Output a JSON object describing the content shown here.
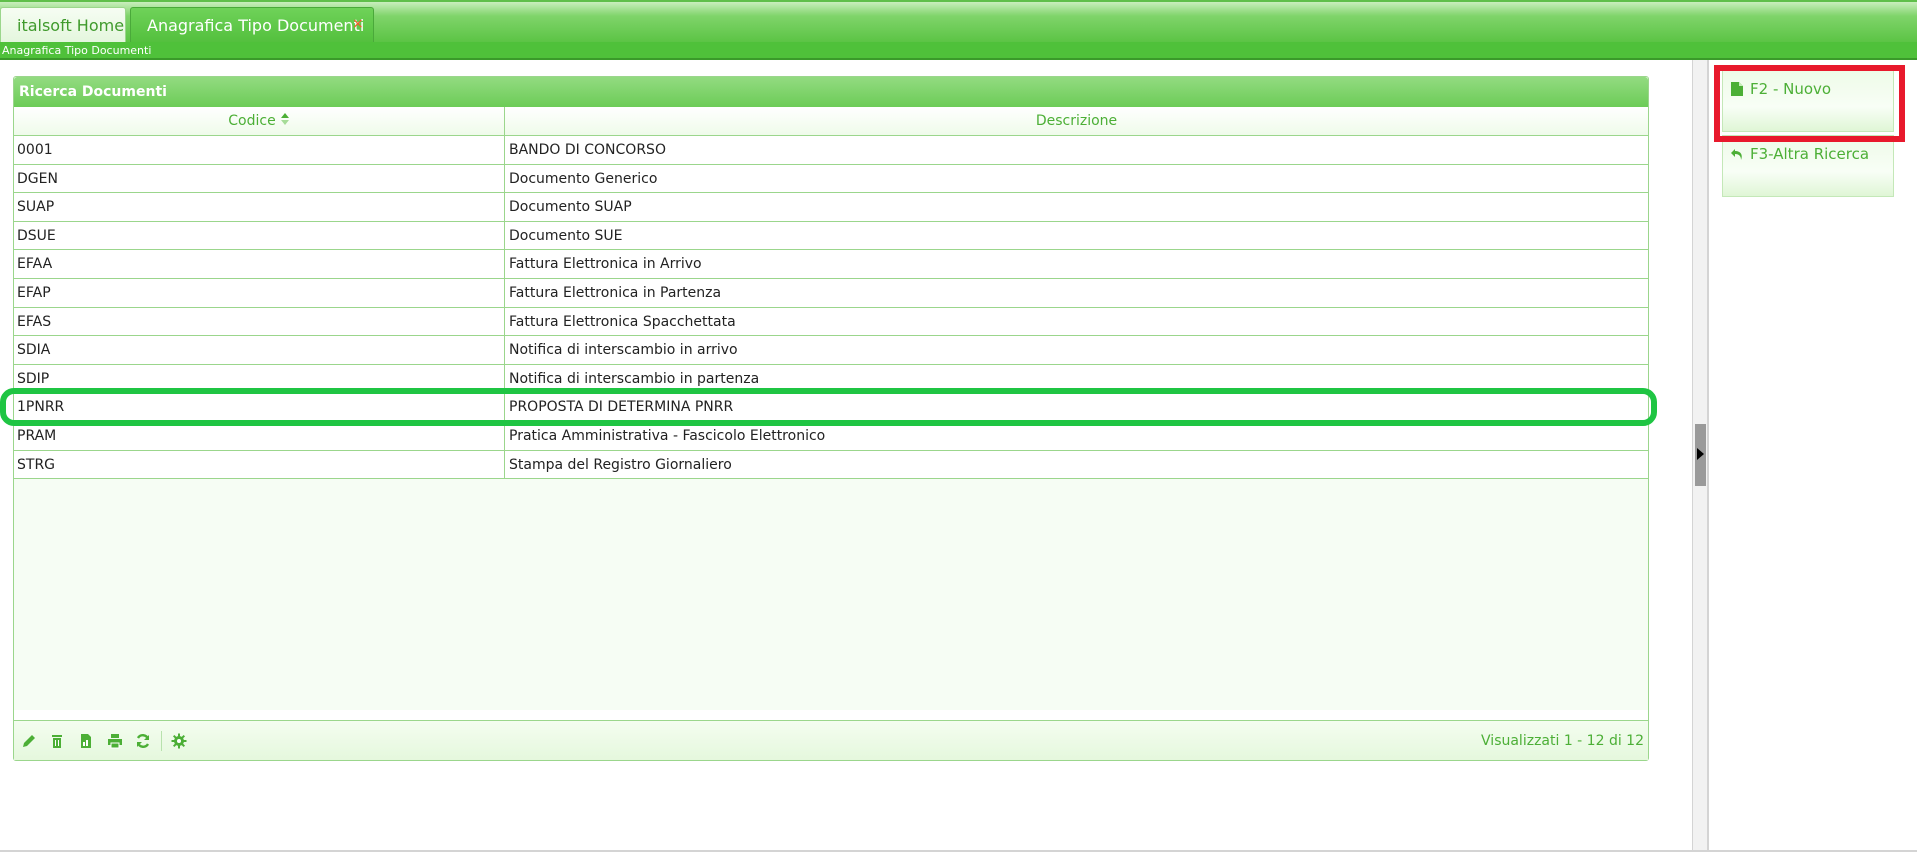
{
  "tabs": {
    "home_label": "italsoft Home",
    "active_label": "Anagrafica Tipo Documenti",
    "close_glyph": "×"
  },
  "breadcrumb": "Anagrafica Tipo Documenti",
  "panel": {
    "title": "Ricerca Documenti",
    "columns": {
      "code": "Codice",
      "description": "Descrizione"
    },
    "rows": [
      {
        "code": "0001",
        "description": "BANDO DI CONCORSO"
      },
      {
        "code": "DGEN",
        "description": "Documento Generico"
      },
      {
        "code": "SUAP",
        "description": "Documento SUAP"
      },
      {
        "code": "DSUE",
        "description": "Documento SUE"
      },
      {
        "code": "EFAA",
        "description": "Fattura Elettronica in Arrivo"
      },
      {
        "code": "EFAP",
        "description": "Fattura Elettronica in Partenza"
      },
      {
        "code": "EFAS",
        "description": "Fattura Elettronica Spacchettata"
      },
      {
        "code": "SDIA",
        "description": "Notifica di interscambio in arrivo"
      },
      {
        "code": "SDIP",
        "description": "Notifica di interscambio in partenza"
      },
      {
        "code": "1PNRR",
        "description": "PROPOSTA DI DETERMINA PNRR"
      },
      {
        "code": "PRAM",
        "description": "Pratica Amministrativa - Fascicolo Elettronico"
      },
      {
        "code": "STRG",
        "description": "Stampa del Registro Giornaliero"
      }
    ],
    "pager_text": "Visualizzati 1 - 12 di 12",
    "footer_icons": [
      "pencil-icon",
      "trash-icon",
      "export-icon",
      "print-icon",
      "refresh-icon",
      "gear-icon"
    ]
  },
  "actions": {
    "new_label": "F2 - Nuovo",
    "search_label": "F3-Altra Ricerca"
  },
  "colors": {
    "accent_green": "#4fc13a",
    "text_green": "#4caf36",
    "highlight_green": "#1fc543",
    "highlight_red": "#e8192c"
  }
}
